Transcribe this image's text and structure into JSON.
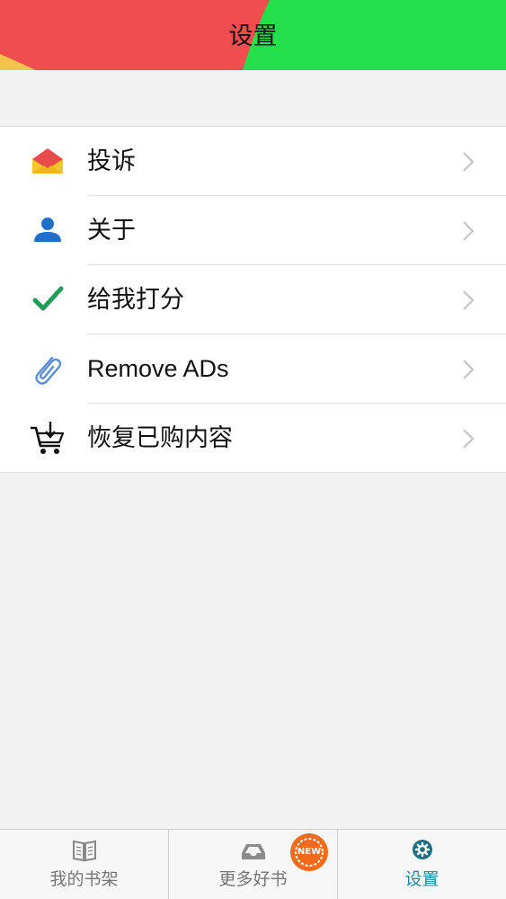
{
  "header": {
    "title": "设置",
    "colors": {
      "left": "#f04e4e",
      "right": "#22e04a"
    }
  },
  "settings": {
    "items": [
      {
        "label": "投诉",
        "icon": "envelope-icon"
      },
      {
        "label": "关于",
        "icon": "user-icon"
      },
      {
        "label": "给我打分",
        "icon": "checkmark-icon"
      },
      {
        "label": "Remove ADs",
        "icon": "paperclip-icon"
      },
      {
        "label": "恢复已购内容",
        "icon": "cart-download-icon"
      }
    ],
    "chevron_icon": "chevron-right-icon"
  },
  "tabbar": {
    "tabs": [
      {
        "label": "我的书架",
        "icon": "book-icon",
        "active": false
      },
      {
        "label": "更多好书",
        "icon": "inbox-tray-icon",
        "active": false
      },
      {
        "label": "设置",
        "icon": "gear-icon",
        "active": true
      }
    ],
    "badge": "NEW",
    "colors": {
      "active": "#1e8ea8",
      "inactive": "#777777",
      "badge": "#f26a1b"
    }
  }
}
